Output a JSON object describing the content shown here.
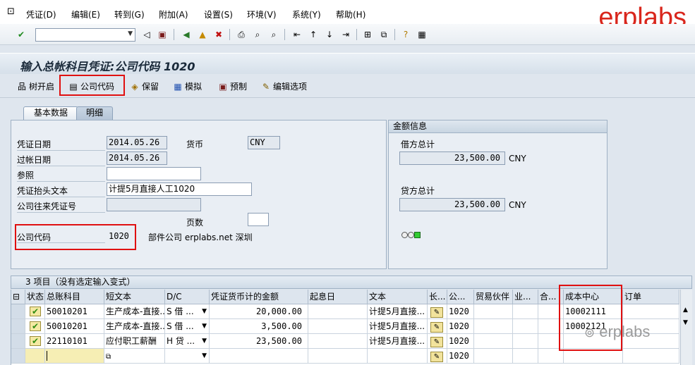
{
  "menubar": {
    "items": [
      "凭证(D)",
      "编辑(E)",
      "转到(G)",
      "附加(A)",
      "设置(S)",
      "环境(V)",
      "系统(Y)",
      "帮助(H)"
    ],
    "brand": "erplabs"
  },
  "title": "输入总帐科目凭证:公司代码 1020",
  "app_toolbar": {
    "tree": "树开启",
    "company_code": "公司代码",
    "hold": "保留",
    "simulate": "模拟",
    "park": "预制",
    "edit_options": "编辑选项"
  },
  "tabs": [
    "基本数据",
    "明细"
  ],
  "header": {
    "doc_date_label": "凭证日期",
    "doc_date": "2014.05.26",
    "currency_label": "货币",
    "currency": "CNY",
    "posting_date_label": "过帐日期",
    "posting_date": "2014.05.26",
    "reference_label": "参照",
    "reference": "",
    "header_text_label": "凭证抬头文本",
    "header_text": "计提5月直接人工1020",
    "intercompany_label": "公司往来凭证号",
    "pages_label": "页数",
    "company_code_label": "公司代码",
    "company_code": "1020",
    "company_name": "部件公司 erplabs.net 深圳"
  },
  "amounts": {
    "panel_title": "金额信息",
    "debit_label": "借方总计",
    "debit": "23,500.00",
    "debit_currency": "CNY",
    "credit_label": "贷方总计",
    "credit": "23,500.00",
    "credit_currency": "CNY"
  },
  "table": {
    "title": "3 项目（没有选定输入变式）",
    "columns": [
      "状态",
      "总账科目",
      "短文本",
      "D/C",
      "凭证货币计的金额",
      "起息日",
      "文本",
      "长...",
      "公...",
      "贸易伙伴",
      "业...",
      "合...",
      "成本中心",
      "订单"
    ],
    "rows": [
      {
        "account": "50010201",
        "short_text": "生产成本-直接...",
        "dc": "S 借 ...",
        "amount": "20,000.00",
        "text": "计提5月直接...",
        "company": "1020",
        "cost_center": "10002111"
      },
      {
        "account": "50010201",
        "short_text": "生产成本-直接...",
        "dc": "S 借 ...",
        "amount": "3,500.00",
        "text": "计提5月直接...",
        "company": "1020",
        "cost_center": "10002121"
      },
      {
        "account": "22110101",
        "short_text": "应付职工薪酬",
        "dc": "H 贷 ...",
        "amount": "23,500.00",
        "text": "计提5月直接...",
        "company": "1020",
        "cost_center": ""
      },
      {
        "account": "",
        "short_text": "",
        "dc": "",
        "amount": "",
        "text": "",
        "company": "1020",
        "cost_center": ""
      }
    ]
  },
  "colors": {
    "brand_red": "#d9261c",
    "highlight_red": "#e01010",
    "status_green": "#2e8b12"
  }
}
